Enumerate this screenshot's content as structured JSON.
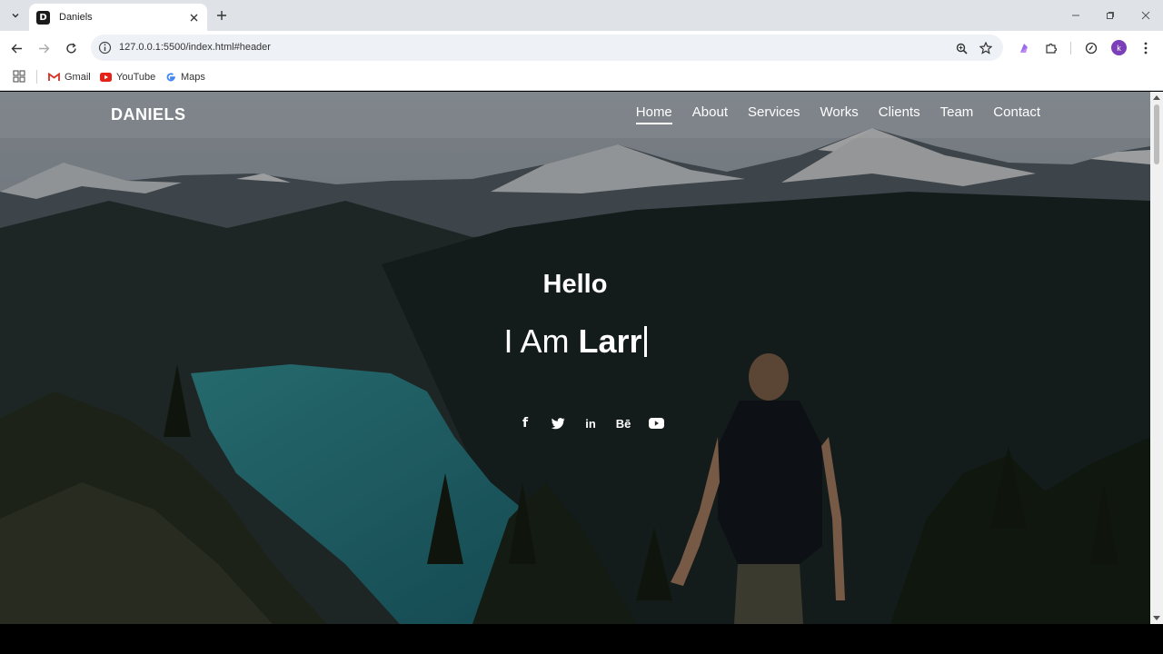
{
  "browser": {
    "tab_title": "Daniels",
    "favicon_letter": "D",
    "url": "127.0.0.1:5500/index.html#header",
    "profile_initial": "k",
    "bookmarks": [
      {
        "label": "Gmail",
        "icon": "gmail-icon"
      },
      {
        "label": "YouTube",
        "icon": "youtube-icon"
      },
      {
        "label": "Maps",
        "icon": "google-icon"
      }
    ]
  },
  "site": {
    "logo": "DANIELS",
    "nav": [
      {
        "label": "Home",
        "active": true
      },
      {
        "label": "About"
      },
      {
        "label": "Services"
      },
      {
        "label": "Works"
      },
      {
        "label": "Clients"
      },
      {
        "label": "Team"
      },
      {
        "label": "Contact"
      }
    ],
    "hero": {
      "greeting": "Hello",
      "prefix": "I Am ",
      "typed_name": "Larr"
    },
    "social": [
      {
        "icon": "facebook-icon",
        "glyph": "f"
      },
      {
        "icon": "twitter-icon"
      },
      {
        "icon": "linkedin-icon",
        "glyph": "in"
      },
      {
        "icon": "behance-icon",
        "glyph": "Bē"
      },
      {
        "icon": "youtube-icon"
      }
    ]
  },
  "colors": {
    "accent_profile": "#7b3fb8",
    "nav_text": "#ffffff"
  }
}
